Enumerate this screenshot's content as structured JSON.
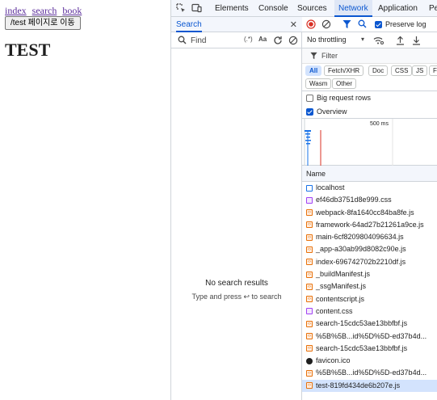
{
  "page": {
    "links": [
      "index",
      "search",
      "book"
    ],
    "button_label": "/test 페이지로 이동",
    "heading": "TEST"
  },
  "devtools": {
    "tabs": [
      {
        "label": "Elements",
        "active": false
      },
      {
        "label": "Console",
        "active": false
      },
      {
        "label": "Sources",
        "active": false
      },
      {
        "label": "Network",
        "active": true
      },
      {
        "label": "Application",
        "active": false
      },
      {
        "label": "Pe",
        "active": false
      }
    ],
    "search": {
      "title": "Search",
      "placeholder": "Find",
      "regex_label": "(.*)",
      "case_label": "Aa",
      "empty_title": "No search results",
      "empty_hint": "Type and press ↩ to search"
    },
    "network": {
      "preserve_log_label": "Preserve log",
      "preserve_log_checked": true,
      "throttling": "No throttling",
      "filter_placeholder": "Filter",
      "type_filters": [
        "All",
        "Fetch/XHR",
        "Doc",
        "CSS",
        "JS",
        "F",
        "Wasm",
        "Other"
      ],
      "active_type": "All",
      "big_rows_label": "Big request rows",
      "big_rows_checked": false,
      "overview_label": "Overview",
      "overview_checked": true,
      "timeline_tick": "500 ms",
      "name_header": "Name",
      "requests": [
        {
          "name": "localhost",
          "type": "doc"
        },
        {
          "name": "ef46db3751d8e999.css",
          "type": "css"
        },
        {
          "name": "webpack-8fa1640cc84ba8fe.js",
          "type": "js"
        },
        {
          "name": "framework-64ad27b21261a9ce.js",
          "type": "js"
        },
        {
          "name": "main-6cf8209804096634.js",
          "type": "js"
        },
        {
          "name": "_app-a30ab99d8082c90e.js",
          "type": "js"
        },
        {
          "name": "index-696742702b2210df.js",
          "type": "js"
        },
        {
          "name": "_buildManifest.js",
          "type": "js"
        },
        {
          "name": "_ssgManifest.js",
          "type": "js"
        },
        {
          "name": "contentscript.js",
          "type": "js"
        },
        {
          "name": "content.css",
          "type": "css"
        },
        {
          "name": "search-15cdc53ae13bbfbf.js",
          "type": "js"
        },
        {
          "name": "%5B%5B...id%5D%5D-ed37b4d...",
          "type": "js"
        },
        {
          "name": "search-15cdc53ae13bbfbf.js",
          "type": "js"
        },
        {
          "name": "favicon.ico",
          "type": "fav"
        },
        {
          "name": "%5B%5B...id%5D%5D-ed37b4d...",
          "type": "js"
        },
        {
          "name": "test-819fd434de6b207e.js",
          "type": "js",
          "selected": true
        }
      ]
    }
  }
}
